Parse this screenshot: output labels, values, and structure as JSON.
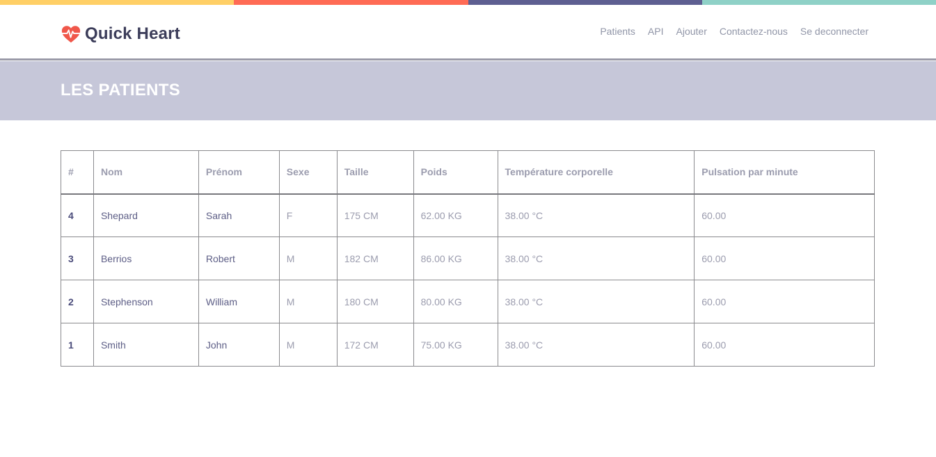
{
  "brand": {
    "name": "Quick Heart",
    "icon": "heart-pulse-icon",
    "icon_color": "#f0574a"
  },
  "nav": [
    {
      "label": "Patients"
    },
    {
      "label": "API"
    },
    {
      "label": "Ajouter"
    },
    {
      "label": "Contactez-nous"
    },
    {
      "label": "Se deconnecter"
    }
  ],
  "page": {
    "title": "LES PATIENTS"
  },
  "colors": {
    "stripe": [
      "#ffcf66",
      "#ff6b55",
      "#5e5f91",
      "#8fd1c7"
    ],
    "title_band": "#c6c7d9",
    "brand_text": "#3c3d5a"
  },
  "table": {
    "headers": [
      "#",
      "Nom",
      "Prénom",
      "Sexe",
      "Taille",
      "Poids",
      "Température corporelle",
      "Pulsation par minute"
    ],
    "rows": [
      [
        "4",
        "Shepard",
        "Sarah",
        "F",
        "175 CM",
        "62.00 KG",
        "38.00 °C",
        "60.00"
      ],
      [
        "3",
        "Berrios",
        "Robert",
        "M",
        "182 CM",
        "86.00 KG",
        "38.00 °C",
        "60.00"
      ],
      [
        "2",
        "Stephenson",
        "William",
        "M",
        "180 CM",
        "80.00 KG",
        "38.00 °C",
        "60.00"
      ],
      [
        "1",
        "Smith",
        "John",
        "M",
        "172 CM",
        "75.00 KG",
        "38.00 °C",
        "60.00"
      ]
    ]
  }
}
